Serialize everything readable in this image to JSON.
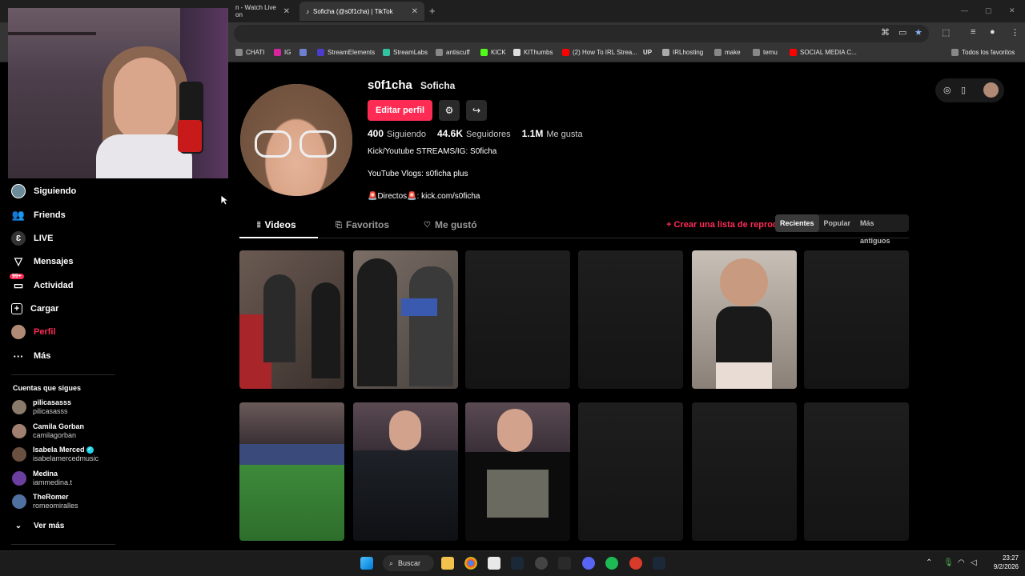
{
  "browser": {
    "tabs": [
      {
        "title": "n - Watch Live on",
        "close": "✕"
      },
      {
        "title": "Soficha (@s0f1cha) | TikTok",
        "close": "✕"
      }
    ],
    "new_tab": "+",
    "bookmarks": [
      {
        "label": "CHATI",
        "color": "#888888"
      },
      {
        "label": "IG",
        "color": "#d6249f"
      },
      {
        "label": "",
        "color": "#6e7fcf"
      },
      {
        "label": "StreamElements",
        "color": "#4b3cc9"
      },
      {
        "label": "StreamLabs",
        "color": "#31c3a2"
      },
      {
        "label": "antiscuff",
        "color": "#888888"
      },
      {
        "label": "KICK",
        "color": "#53fc18"
      },
      {
        "label": "KIThumbs",
        "color": "#dddddd"
      },
      {
        "label": "(2) How To IRL Strea...",
        "color": "#ff0000"
      },
      {
        "label": "IRLhosting",
        "color": "#aaaaaa"
      },
      {
        "label": "make",
        "color": "#888888"
      },
      {
        "label": "temu",
        "color": "#888888"
      },
      {
        "label": "SOCIAL MEDIA C...",
        "color": "#ff0000"
      },
      {
        "label": "Todos los favoritos",
        "color": "#888888"
      }
    ]
  },
  "sidebar": {
    "items": [
      {
        "label": "Siguiendo",
        "icon": "avatar-icon"
      },
      {
        "label": "Friends",
        "icon": "friends-icon"
      },
      {
        "label": "LIVE",
        "icon": "live-icon"
      },
      {
        "label": "Mensajes",
        "icon": "messages-icon"
      },
      {
        "label": "Actividad",
        "icon": "activity-icon",
        "badge": "99+"
      },
      {
        "label": "Cargar",
        "icon": "upload-icon"
      },
      {
        "label": "Perfil",
        "icon": "profile-icon"
      },
      {
        "label": "Más",
        "icon": "more-icon"
      }
    ],
    "following_title": "Cuentas que sigues",
    "following": [
      {
        "name": "pilicasasss",
        "user": "pilicasasss",
        "color": "#8a7a6a"
      },
      {
        "name": "Camila Gorban",
        "user": "camilagorban",
        "color": "#a08070"
      },
      {
        "name": "Isabela Merced",
        "user": "isabelamercedmusic",
        "color": "#6a5040",
        "verified": true
      },
      {
        "name": "Medina",
        "user": "iammedina.t",
        "color": "#6b3fa0"
      },
      {
        "name": "TheRomer",
        "user": "romeomiralles",
        "color": "#5070a0"
      }
    ],
    "see_more": "Ver más"
  },
  "profile": {
    "handle": "s0f1cha",
    "nickname": "Soficha",
    "edit_button": "Editar perfil",
    "stats": [
      {
        "value": "400",
        "label": "Siguiendo"
      },
      {
        "value": "44.6K",
        "label": "Seguidores"
      },
      {
        "value": "1.1M",
        "label": "Me gusta"
      }
    ],
    "bio": [
      "Kick/Youtube STREAMS/IG: S0ficha",
      "YouTube Vlogs: s0ficha plus",
      "🚨Directos🚨: kick.com/s0ficha"
    ]
  },
  "content_tabs": [
    {
      "label": "Videos",
      "icon": "grid-icon"
    },
    {
      "label": "Favoritos",
      "icon": "bookmark-icon"
    },
    {
      "label": "Me gustó",
      "icon": "heart-icon"
    }
  ],
  "playlist_label": "+ Crear una lista de reproducción",
  "sort": [
    "Recientes",
    "Popular",
    "Más antiguos"
  ],
  "taskbar": {
    "search": "Buscar",
    "time": "23:27",
    "date": "9/2/2026"
  }
}
